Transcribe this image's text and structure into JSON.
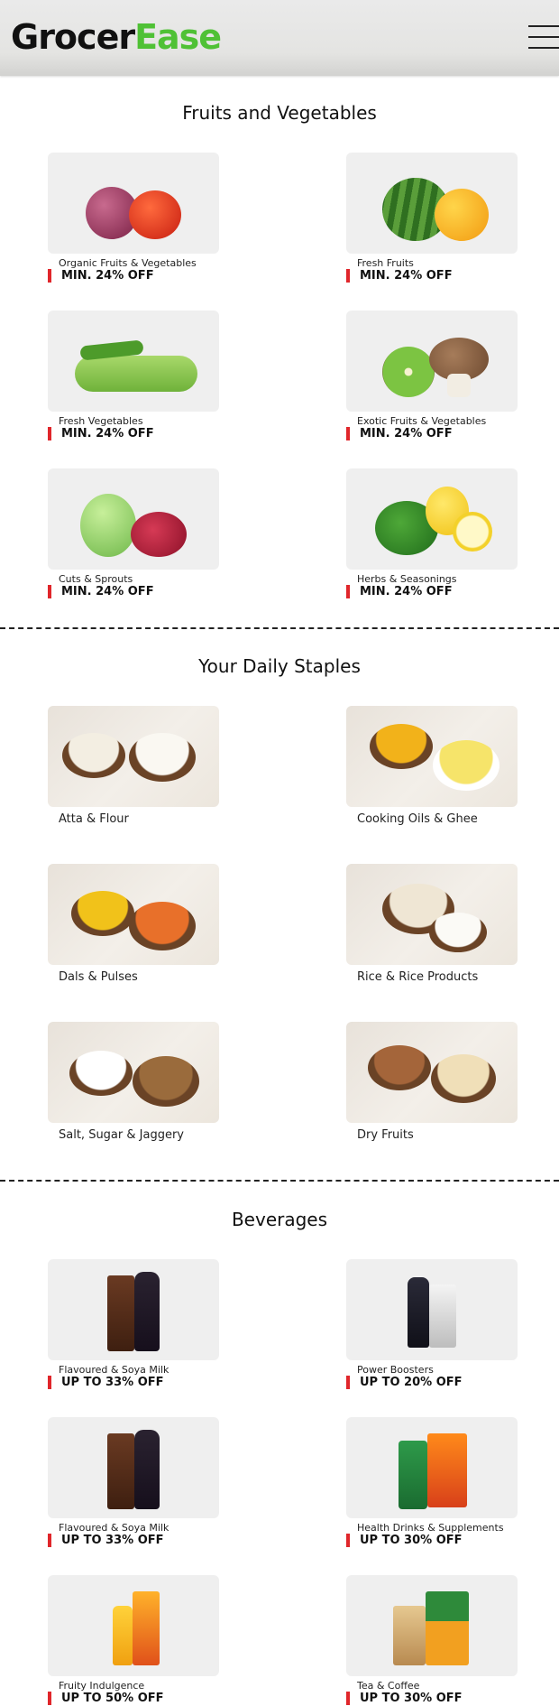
{
  "header": {
    "logo_part1": "Grocer",
    "logo_part2": "Ease",
    "menu_icon": "hamburger-menu-icon"
  },
  "sections": [
    {
      "title": "Fruits and Vegetables",
      "items": [
        {
          "name": "Organic Fruits & Vegetables",
          "discount": "MIN. 24% OFF",
          "icon": "onion-tomato-image"
        },
        {
          "name": "Fresh Fruits",
          "discount": "MIN. 24% OFF",
          "icon": "watermelon-mango-image"
        },
        {
          "name": "Fresh Vegetables",
          "discount": "MIN. 24% OFF",
          "icon": "okra-gourd-image"
        },
        {
          "name": "Exotic Fruits & Vegetables",
          "discount": "MIN. 24% OFF",
          "icon": "kiwi-mushroom-image"
        },
        {
          "name": "Cuts & Sprouts",
          "discount": "MIN. 24% OFF",
          "icon": "coconut-pomegranate-image"
        },
        {
          "name": "Herbs & Seasonings",
          "discount": "MIN. 24% OFF",
          "icon": "mint-lemon-image"
        }
      ]
    },
    {
      "title": "Your Daily Staples",
      "items": [
        {
          "name": "Atta & Flour",
          "icon": "flour-bowls-image"
        },
        {
          "name": "Cooking Oils & Ghee",
          "icon": "oil-ghee-bowls-image"
        },
        {
          "name": "Dals & Pulses",
          "icon": "dal-bowls-image"
        },
        {
          "name": "Rice & Rice Products",
          "icon": "rice-bowls-image"
        },
        {
          "name": "Salt, Sugar & Jaggery",
          "icon": "salt-sugar-bowls-image"
        },
        {
          "name": "Dry Fruits",
          "icon": "dry-fruits-bowls-image"
        }
      ]
    },
    {
      "title": "Beverages",
      "items": [
        {
          "name": "Flavoured & Soya Milk",
          "discount": "UP TO 33% OFF",
          "icon": "milk-bottles-image"
        },
        {
          "name": "Power Boosters",
          "discount": "UP TO 20% OFF",
          "icon": "energy-drinks-image"
        },
        {
          "name": "Flavoured & Soya Milk",
          "discount": "UP TO 33% OFF",
          "icon": "milk-bottles-image"
        },
        {
          "name": "Health Drinks & Supplements",
          "discount": "UP TO 30% OFF",
          "icon": "health-drink-jars-image"
        },
        {
          "name": "Fruity Indulgence",
          "discount": "UP TO 50% OFF",
          "icon": "juice-packs-image"
        },
        {
          "name": "Tea & Coffee",
          "discount": "UP TO 30% OFF",
          "icon": "tea-coffee-packs-image"
        }
      ]
    }
  ],
  "colors": {
    "brand_green": "#4fc135",
    "discount_accent": "#e0262b"
  }
}
